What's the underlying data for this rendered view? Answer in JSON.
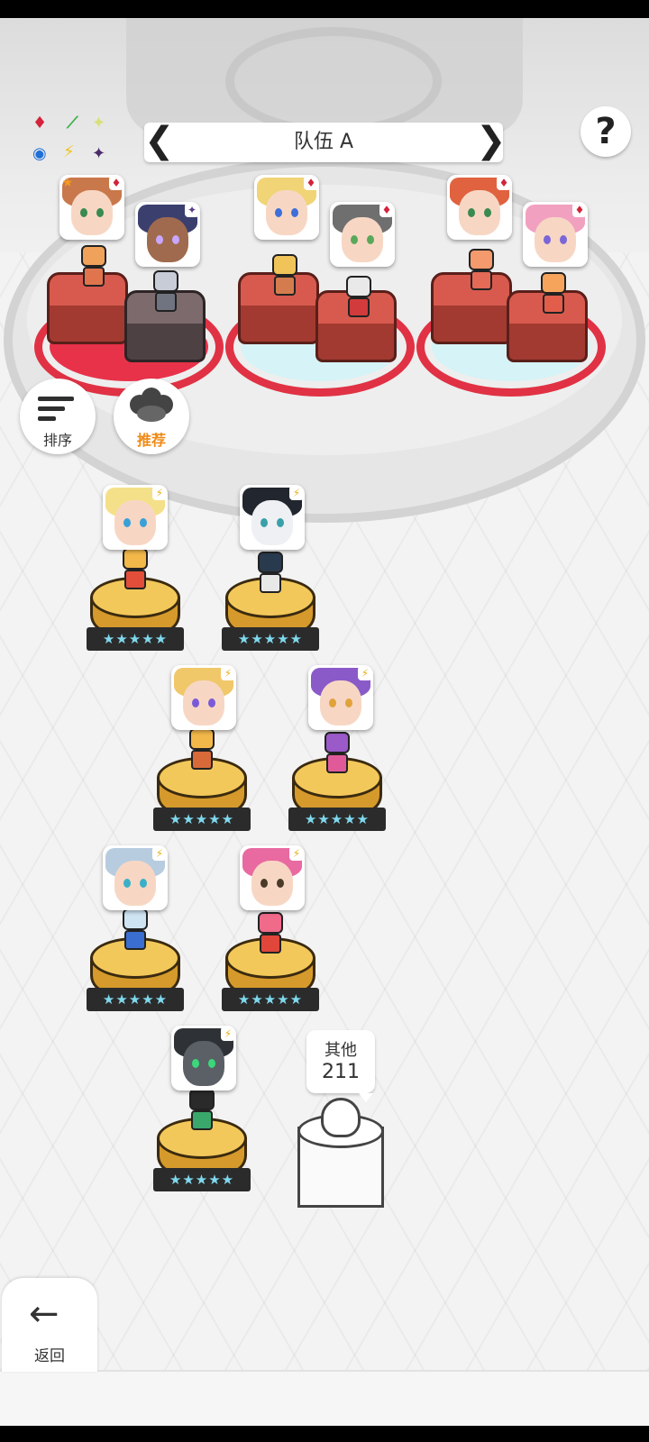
{
  "header": {
    "team_title": "队伍 A",
    "prev_arrow": "❮",
    "next_arrow": "❯",
    "help_label": "?"
  },
  "element_chart": {
    "diamond": "♦",
    "leaf": "⟋",
    "sparkle": "✦",
    "orb": "◉",
    "bolt": "⚡",
    "dark": "✦"
  },
  "buttons": {
    "sort_label": "排序",
    "recommend_label": "推荐",
    "back_arrow": "←",
    "back_label": "返回"
  },
  "team_slots": [
    {
      "hero_badge": "♦"
    },
    {
      "hero_badge": "✦"
    },
    {
      "hero_badge": "♦"
    },
    {
      "hero_badge": "♦"
    },
    {
      "hero_badge": "♦"
    },
    {
      "hero_badge": "♦"
    }
  ],
  "roster": {
    "star_rating": "★★★★★",
    "badge": "⚡"
  },
  "other_box": {
    "label": "其他",
    "count": "211"
  },
  "colors": {
    "accent_red": "#e03244",
    "pedestal_gold": "#f3c85a",
    "star_cyan": "#7fd9ee",
    "badge_yellow": "#e7b21a"
  }
}
